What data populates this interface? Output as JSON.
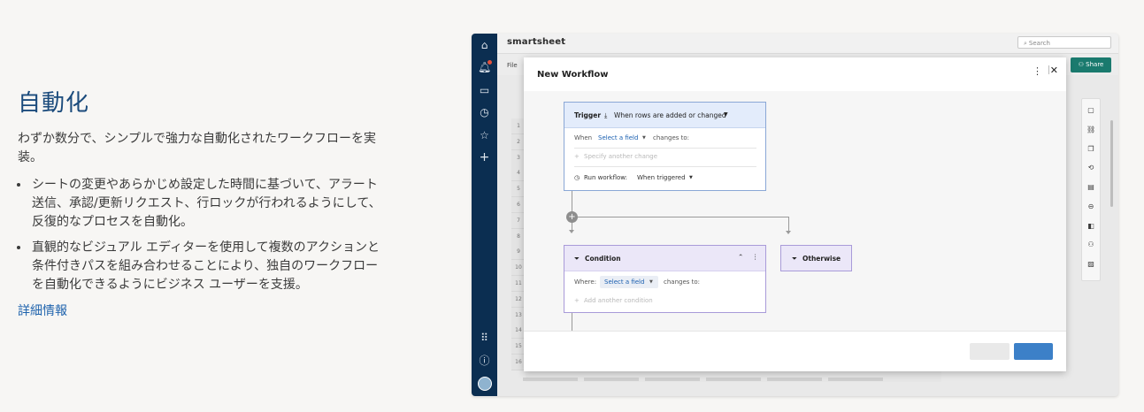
{
  "copy": {
    "title": "自動化",
    "lead": "わずか数分で、シンプルで強力な自動化されたワークフローを実装。",
    "bullets": [
      "シートの変更やあらかじめ設定した時間に基づいて、アラート送信、承認/更新リクエスト、行ロックが行われるようにして、反復的なプロセスを自動化。",
      "直観的なビジュアル エディターを使用して複数のアクションと条件付きパスを組み合わせることにより、独自のワークフローを自動化できるようにビジネス ユーザーを支援。"
    ],
    "link": "詳細情報"
  },
  "app": {
    "brand": "smartsheet",
    "search_placeholder": "Search",
    "menu_file": "File",
    "share_label": "Share",
    "row_numbers": [
      "1",
      "2",
      "3",
      "4",
      "5",
      "6",
      "7",
      "8",
      "9",
      "10",
      "11",
      "12",
      "13",
      "14",
      "15",
      "16"
    ],
    "rail_icons": [
      "home-icon",
      "bell-icon",
      "folder-icon",
      "clock-icon",
      "star-icon",
      "plus-icon",
      "apps-icon",
      "help-icon",
      "avatar"
    ],
    "right_icons": [
      "comment-icon",
      "link-icon",
      "copy-icon",
      "activity-icon",
      "attachment-icon",
      "update-icon",
      "summary-icon",
      "people-icon",
      "report-icon"
    ]
  },
  "workflow": {
    "title": "New Workflow",
    "trigger": {
      "label": "Trigger",
      "event": "When rows are added or changed",
      "when_label": "When",
      "field": "Select a field",
      "changes_to": "changes to:",
      "add_change": "Specify another change",
      "run_label": "Run workflow:",
      "run_value": "When triggered"
    },
    "condition": {
      "label": "Condition",
      "where_label": "Where:",
      "field": "Select a field",
      "changes_to": "changes to:",
      "add_condition": "Add another condition"
    },
    "otherwise": "Otherwise"
  },
  "colors": {
    "rail": "#0b2e51",
    "share": "#1a7a6e",
    "primary_button": "#3c80c8",
    "trigger_header": "#e3ecfb",
    "condition_header": "#ebe7f8"
  }
}
